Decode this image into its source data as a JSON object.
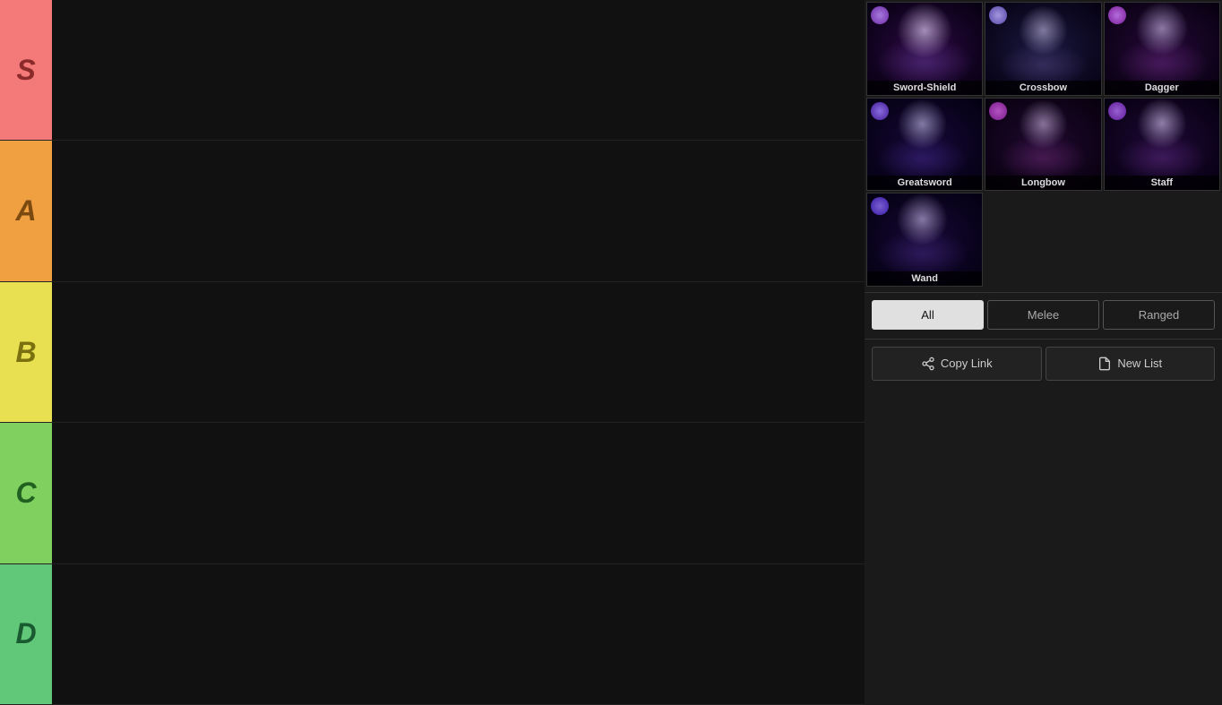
{
  "tiers": [
    {
      "id": "s",
      "label": "S",
      "color": "#f47a7a"
    },
    {
      "id": "a",
      "label": "A",
      "color": "#f0a040"
    },
    {
      "id": "b",
      "label": "B",
      "color": "#e8e050"
    },
    {
      "id": "c",
      "label": "C",
      "color": "#80d060"
    },
    {
      "id": "d",
      "label": "D",
      "color": "#60c878"
    }
  ],
  "characters": [
    {
      "id": "sword-shield",
      "name": "Sword-Shield",
      "portrait_class": "portrait-sword-shield",
      "orb_class": "orb-sword"
    },
    {
      "id": "crossbow",
      "name": "Crossbow",
      "portrait_class": "portrait-crossbow",
      "orb_class": "orb-crossbow"
    },
    {
      "id": "dagger",
      "name": "Dagger",
      "portrait_class": "portrait-dagger",
      "orb_class": "orb-dagger"
    },
    {
      "id": "greatsword",
      "name": "Greatsword",
      "portrait_class": "portrait-greatsword",
      "orb_class": "orb-greatsword"
    },
    {
      "id": "longbow",
      "name": "Longbow",
      "portrait_class": "portrait-longbow",
      "orb_class": "orb-longbow"
    },
    {
      "id": "staff",
      "name": "Staff",
      "portrait_class": "portrait-staff",
      "orb_class": "orb-staff"
    },
    {
      "id": "wand",
      "name": "Wand",
      "portrait_class": "portrait-wand",
      "orb_class": "orb-wand"
    }
  ],
  "filters": [
    {
      "id": "all",
      "label": "All",
      "active": true
    },
    {
      "id": "melee",
      "label": "Melee",
      "active": false
    },
    {
      "id": "ranged",
      "label": "Ranged",
      "active": false
    }
  ],
  "actions": [
    {
      "id": "copy-link",
      "label": "Copy Link",
      "icon": "share"
    },
    {
      "id": "new-list",
      "label": "New List",
      "icon": "file"
    }
  ]
}
